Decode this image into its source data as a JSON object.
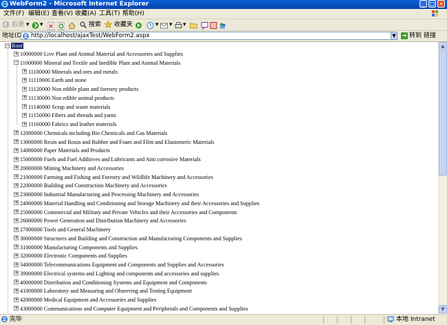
{
  "window": {
    "title": "WebForm2 - Microsoft Internet Explorer"
  },
  "menu": [
    "文件(F)",
    "编辑(E)",
    "查看(V)",
    "收藏(A)",
    "工具(T)",
    "帮助(H)"
  ],
  "toolbar": {
    "back_label": "后退",
    "search_label": "搜索",
    "favorites_label": "收藏夹"
  },
  "address": {
    "label": "地址(D)",
    "url": "http://localhost/ajaxTest/WebForm2.aspx",
    "go_label": "转到",
    "links_label": "链接"
  },
  "tree": {
    "root": "Root",
    "nodes": [
      {
        "label": "10000000 Live Plant and Animal Material and Accessories and Supplies",
        "expanded": false,
        "level": 1
      },
      {
        "label": "11000000 Mineral and Textile and Inedible Plant and Animal Materials",
        "expanded": true,
        "level": 1
      },
      {
        "label": "11100000 Minerals and ores and metals",
        "expanded": false,
        "level": 2
      },
      {
        "label": "11110000 Earth and stone",
        "expanded": false,
        "level": 2
      },
      {
        "label": "11120000 Non edible plant and forestry products",
        "expanded": false,
        "level": 2
      },
      {
        "label": "11130000 Non edible animal products",
        "expanded": false,
        "level": 2
      },
      {
        "label": "11140000 Scrap and waste materials",
        "expanded": false,
        "level": 2
      },
      {
        "label": "11150000 Fibers and threads and yarns",
        "expanded": false,
        "level": 2
      },
      {
        "label": "11160000 Fabrics and leather materials",
        "expanded": false,
        "level": 2
      },
      {
        "label": "12000000 Chemicals including Bio Chemicals and Gas Materials",
        "expanded": false,
        "level": 1
      },
      {
        "label": "13000000 Resin and Rosin and Rubber and Foam and Film and Elastomeric Materials",
        "expanded": false,
        "level": 1
      },
      {
        "label": "14000000 Paper Materials and Products",
        "expanded": false,
        "level": 1
      },
      {
        "label": "15000000 Fuels and Fuel Additives and Lubricants and Anti corrosive Materials",
        "expanded": false,
        "level": 1
      },
      {
        "label": "20000000 Mining Machinery and Accessories",
        "expanded": false,
        "level": 1
      },
      {
        "label": "21000000 Farming and Fishing and Forestry and Wildlife Machinery and Accessories",
        "expanded": false,
        "level": 1
      },
      {
        "label": "22000000 Building and Construction Machinery and Accessories",
        "expanded": false,
        "level": 1
      },
      {
        "label": "23000000 Industrial Manufacturing and Processing Machinery and Accessories",
        "expanded": false,
        "level": 1
      },
      {
        "label": "24000000 Material Handling and Conditioning and Storage Machinery and their Accessories and Supplies",
        "expanded": false,
        "level": 1
      },
      {
        "label": "25000000 Commercial and Military and Private Vehicles and their Accessories and Components",
        "expanded": false,
        "level": 1
      },
      {
        "label": "26000000 Power Generation and Distribution Machinery and Accessories",
        "expanded": false,
        "level": 1
      },
      {
        "label": "27000000 Tools and General Machinery",
        "expanded": false,
        "level": 1
      },
      {
        "label": "30000000 Structures and Building and Construction and Manufacturing Components and Supplies",
        "expanded": false,
        "level": 1
      },
      {
        "label": "31000000 Manufacturing Components and Supplies",
        "expanded": false,
        "level": 1
      },
      {
        "label": "32000000 Electronic Components and Supplies",
        "expanded": false,
        "level": 1
      },
      {
        "label": "34000000 Telecommunications Equipment and Components and Supplies and Accessories",
        "expanded": false,
        "level": 1
      },
      {
        "label": "39000000 Electrical systems and Lighting and components and accessories and supplies",
        "expanded": false,
        "level": 1
      },
      {
        "label": "40000000 Distribution and Conditioning Systems and Equipment and Components",
        "expanded": false,
        "level": 1
      },
      {
        "label": "41000000 Laboratory and Measuring and Observing and Testing Equipment",
        "expanded": false,
        "level": 1
      },
      {
        "label": "42000000 Medical Equipment and Accessories and Supplies",
        "expanded": false,
        "level": 1
      },
      {
        "label": "43000000 Communications and Computer Equipment and Peripherals and Components and Supplies",
        "expanded": false,
        "level": 1
      }
    ]
  },
  "status": {
    "text": "完毕",
    "zone": "本地 Intranet"
  }
}
